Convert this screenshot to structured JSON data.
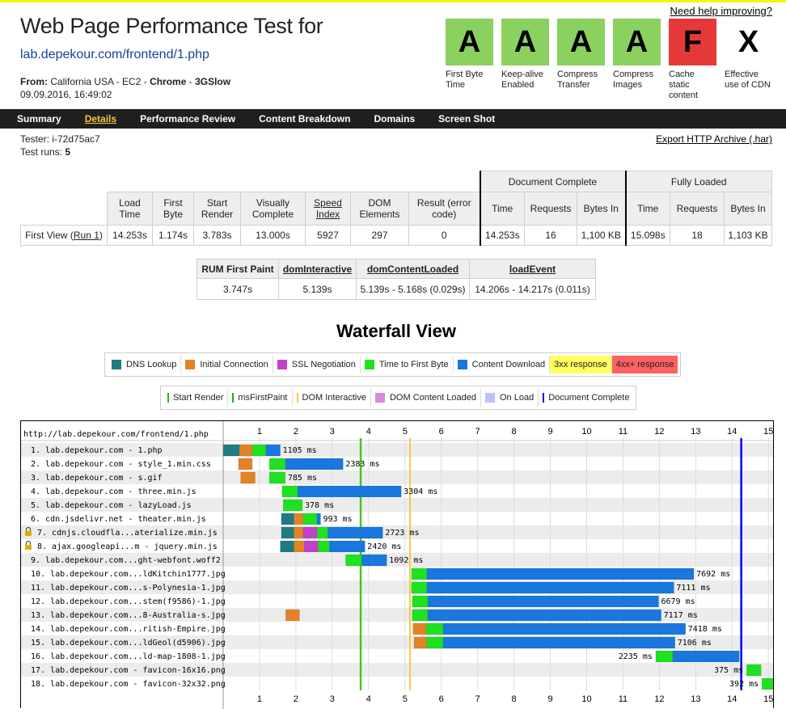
{
  "header": {
    "title": "Web Page Performance Test for",
    "url": "lab.depekour.com/frontend/1.php",
    "from_label": "From:",
    "location": "California USA - EC2 - ",
    "browser": "Chrome",
    "connection": "3GSlow",
    "date": "09.09.2016, 16:49:02",
    "help": "Need help improving?"
  },
  "grades": [
    {
      "grade": "A",
      "label": "First Byte Time",
      "kind": "a"
    },
    {
      "grade": "A",
      "label": "Keep-alive Enabled",
      "kind": "a"
    },
    {
      "grade": "A",
      "label": "Compress Transfer",
      "kind": "a"
    },
    {
      "grade": "A",
      "label": "Compress Images",
      "kind": "a"
    },
    {
      "grade": "F",
      "label": "Cache static content",
      "kind": "f"
    },
    {
      "grade": "X",
      "label": "Effective use of CDN",
      "kind": "x"
    }
  ],
  "nav": [
    "Summary",
    "Details",
    "Performance Review",
    "Content Breakdown",
    "Domains",
    "Screen Shot"
  ],
  "nav_active": "Details",
  "tester": "Tester: i-72d75ac7",
  "test_runs_label": "Test runs: ",
  "test_runs": "5",
  "export": "Export HTTP Archive (.har)",
  "results": {
    "group_doc": "Document Complete",
    "group_full": "Fully Loaded",
    "headers": [
      "Load Time",
      "First Byte",
      "Start Render",
      "Visually Complete",
      "Speed Index",
      "DOM Elements",
      "Result (error code)"
    ],
    "doc_headers": [
      "Time",
      "Requests",
      "Bytes In"
    ],
    "full_headers": [
      "Time",
      "Requests",
      "Bytes In"
    ],
    "row_label": "First View (",
    "run_link": "Run 1",
    "row_label_end": ")",
    "values": [
      "14.253s",
      "1.174s",
      "3.783s",
      "13.000s",
      "5927",
      "297",
      "0"
    ],
    "doc_values": [
      "14.253s",
      "16",
      "1,100 KB"
    ],
    "full_values": [
      "15.098s",
      "18",
      "1,103 KB"
    ]
  },
  "rum": {
    "headers": [
      "RUM First Paint",
      "domInteractive",
      "domContentLoaded",
      "loadEvent"
    ],
    "values": [
      "3.747s",
      "5.139s",
      "5.139s - 5.168s (0.029s)",
      "14.206s - 14.217s (0.011s)"
    ]
  },
  "waterfall_title": "Waterfall View",
  "legend1": [
    {
      "label": "DNS Lookup",
      "color": "#1f7c83"
    },
    {
      "label": "Initial Connection",
      "color": "#e58226"
    },
    {
      "label": "SSL Negotiation",
      "color": "#c141cd"
    },
    {
      "label": "Time to First Byte",
      "color": "#1fe11f"
    },
    {
      "label": "Content Download",
      "color": "#1977dd"
    },
    {
      "label": "3xx response",
      "bg": "#ffff60"
    },
    {
      "label": "4xx+ response",
      "bg": "#ff6060"
    }
  ],
  "legend2": [
    {
      "label": "Start Render",
      "color": "#28bc00",
      "line": true
    },
    {
      "label": "msFirstPaint",
      "color": "#0cba0c",
      "line": true
    },
    {
      "label": "DOM Interactive",
      "color": "#f5cb3f",
      "line": true
    },
    {
      "label": "DOM Content Loaded",
      "color": "#d888df"
    },
    {
      "label": "On Load",
      "color": "#c0c0ff"
    },
    {
      "label": "Document Complete",
      "color": "#0000ff",
      "line": true
    }
  ],
  "waterfall": {
    "page_url": "http://lab.depekour.com/frontend/1.php",
    "axis_max": 15,
    "ticks": [
      1,
      2,
      3,
      4,
      5,
      6,
      7,
      8,
      9,
      10,
      11,
      12,
      13,
      14,
      15
    ],
    "markers": {
      "start_render": 3.783,
      "dom_interactive": 5.139,
      "document_complete": 14.253
    },
    "requests": [
      {
        "label": "1. lab.depekour.com - 1.php",
        "dns": [
          0,
          0.45
        ],
        "conn": [
          0.45,
          0.8
        ],
        "ttfb": [
          0.8,
          1.174
        ],
        "dl": [
          1.174,
          1.57
        ],
        "ms": "1105 ms"
      },
      {
        "label": "2. lab.depekour.com - style_1.min.css",
        "conn": [
          0.42,
          0.8
        ],
        "ttfb": [
          1.27,
          1.71
        ],
        "dl": [
          1.71,
          3.3
        ],
        "ms": "2383 ms"
      },
      {
        "label": "3. lab.depekour.com - s.gif",
        "conn": [
          0.48,
          0.88
        ],
        "ttfb": [
          1.27,
          1.71
        ],
        "ms": "785 ms"
      },
      {
        "label": "4. lab.depekour.com - three.min.js",
        "ttfb": [
          1.62,
          2.05
        ],
        "dl": [
          2.05,
          4.9
        ],
        "ms": "3304 ms"
      },
      {
        "label": "5. lab.depekour.com - lazyLoad.js",
        "ttfb": [
          1.65,
          2.18
        ],
        "ms": "378 ms"
      },
      {
        "label": "6. cdn.jsdelivr.net - theater.min.js",
        "dns": [
          1.6,
          1.95
        ],
        "conn": [
          1.95,
          2.2
        ],
        "ttfb": [
          2.2,
          2.58
        ],
        "dl": [
          2.58,
          2.68
        ],
        "ms": "993 ms"
      },
      {
        "label": "7. cdnjs.cloudfla...aterialize.min.js",
        "dns": [
          1.6,
          1.95
        ],
        "conn": [
          1.95,
          2.2
        ],
        "ssl": [
          2.2,
          2.58
        ],
        "ttfb": [
          2.58,
          2.88
        ],
        "dl": [
          2.88,
          4.39
        ],
        "ms": "2723 ms",
        "lock": true
      },
      {
        "label": "8. ajax.googleapi...m - jquery.min.js",
        "dns": [
          1.57,
          1.95
        ],
        "conn": [
          1.95,
          2.23
        ],
        "ssl": [
          2.23,
          2.61
        ],
        "ttfb": [
          2.61,
          2.92
        ],
        "dl": [
          2.92,
          3.9
        ],
        "ms": "2420 ms",
        "lock": true
      },
      {
        "label": "9. lab.depekour.com...ght-webfont.woff2",
        "ttfb": [
          3.37,
          3.81
        ],
        "dl": [
          3.81,
          4.5
        ],
        "ms": "1092 ms"
      },
      {
        "label": "10. lab.depekour.com...ldKitchin1777.jpg",
        "ttfb": [
          5.18,
          5.6
        ],
        "dl": [
          5.6,
          12.95
        ],
        "ms": "7692 ms"
      },
      {
        "label": "11. lab.depekour.com...s-Polynesia-1.jpg",
        "ttfb": [
          5.18,
          5.6
        ],
        "dl": [
          5.6,
          12.4
        ],
        "ms": "7111 ms"
      },
      {
        "label": "12. lab.depekour.com...stem(f9586)-1.jpg",
        "ttfb": [
          5.2,
          5.63
        ],
        "dl": [
          5.63,
          11.98
        ],
        "ms": "6679 ms"
      },
      {
        "label": "13. lab.depekour.com...8-Australia-s.jpg",
        "conn": [
          1.72,
          2.1
        ],
        "ttfb": [
          5.2,
          5.63
        ],
        "dl": [
          5.63,
          12.05
        ],
        "ms": "7117 ms"
      },
      {
        "label": "14. lab.depekour.com...ritish-Empire.jpg",
        "conn": [
          5.22,
          5.58
        ],
        "ttfb": [
          5.58,
          6.05
        ],
        "dl": [
          6.05,
          12.72
        ],
        "ms": "7418 ms"
      },
      {
        "label": "15. lab.depekour.com...ldGeol(d5906).jpg",
        "conn": [
          5.25,
          5.6
        ],
        "ttfb": [
          5.6,
          6.05
        ],
        "dl": [
          6.05,
          12.43
        ],
        "ms": "7106 ms"
      },
      {
        "label": "16. lab.depekour.com...ld-map-1808-1.jpg",
        "ttfb": [
          11.9,
          12.37
        ],
        "dl": [
          12.37,
          14.2
        ],
        "ms": "2235 ms"
      },
      {
        "label": "17. lab.depekour.com - favicon-16x16.png",
        "ttfb": [
          14.4,
          14.8
        ],
        "ms": "375 ms"
      },
      {
        "label": "18. lab.depekour.com - favicon-32x32.png",
        "ttfb": [
          14.82,
          15.22
        ],
        "ms": "392 ms"
      }
    ]
  }
}
